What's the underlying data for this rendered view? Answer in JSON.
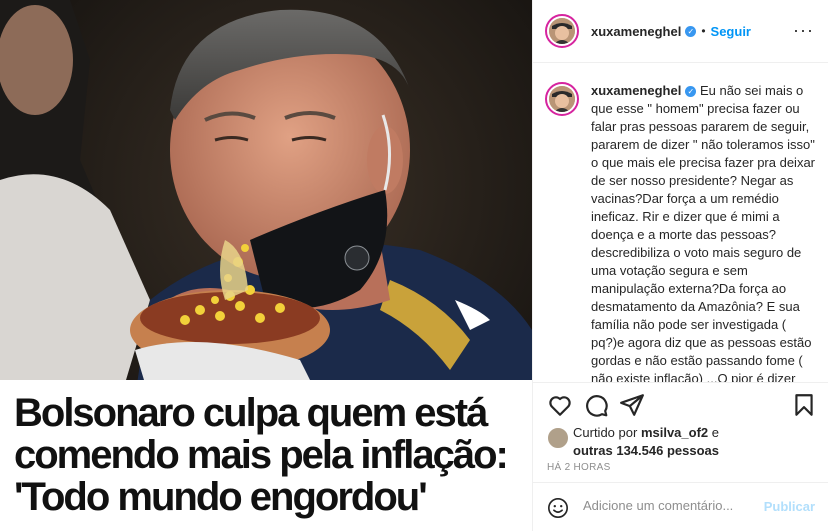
{
  "photo": {
    "headline_lines": [
      "Bolsonaro culpa quem está",
      "comendo mais pela inflação:",
      "'Todo mundo engordou'"
    ]
  },
  "post_header": {
    "username": "xuxameneghel",
    "verified_icon": "verified-badge-icon",
    "separator": "•",
    "follow_label": "Seguir",
    "more_icon": "more-options-icon",
    "more_label": "···"
  },
  "caption": {
    "username": "xuxameneghel",
    "text": "Eu não sei mais o que esse \" homem\" precisa fazer ou falar pras pessoas pararem de seguir, pararem de dizer \" não toleramos isso\" o que mais ele precisa fazer pra deixar de ser nosso presidente? Negar as vacinas?Dar força a um remédio ineficaz. Rir e dizer que é mimi a doença e a morte das pessoas? descredibiliza o voto mais seguro de uma votação segura e sem manipulação externa?Da força ao desmatamento da Amazônia? E sua família não pode ser investigada ( pq?)e agora diz que as pessoas estão gordas e não estão passando fome ( não existe inflação) ...O pior é dizer que Deus esta com ele e seu símbolo são as armas e não o amor e a paz"
  },
  "actions": {
    "like_icon": "heart-icon",
    "comment_icon": "comment-icon",
    "share_icon": "share-icon",
    "save_icon": "bookmark-icon"
  },
  "likes": {
    "prefix": "Curtido por",
    "user": "msilva_of2",
    "connector": "e",
    "others": "outras 134.546 pessoas"
  },
  "timestamp": "HÁ 2 HORAS",
  "comment_box": {
    "emoji_icon": "emoji-icon",
    "placeholder": "Adicione um comentário...",
    "publish_label": "Publicar"
  },
  "colors": {
    "accent": "#0095f6",
    "publish_disabled": "#b2dffc",
    "verified": "#3897f0",
    "text": "#262626",
    "muted": "#8e8e8e"
  }
}
